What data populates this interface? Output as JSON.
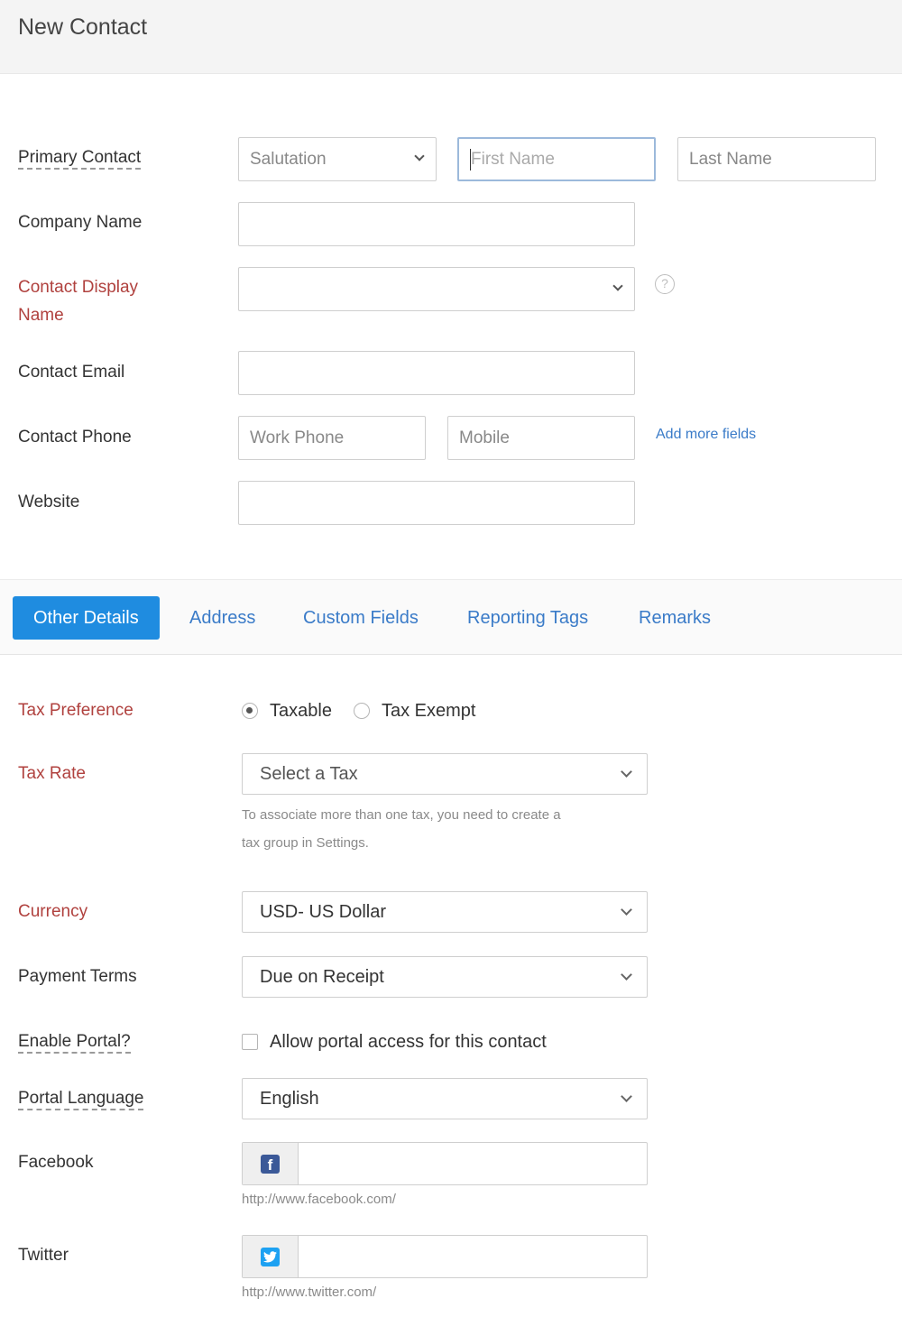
{
  "page": {
    "title": "New Contact"
  },
  "labels": {
    "primary_contact": "Primary Contact",
    "company_name": "Company Name",
    "display_name_line1": "Contact Display",
    "display_name_line2": "Name",
    "contact_email": "Contact Email",
    "contact_phone": "Contact Phone",
    "website": "Website",
    "tax_preference": "Tax Preference",
    "tax_rate": "Tax Rate",
    "currency": "Currency",
    "payment_terms": "Payment Terms",
    "enable_portal": "Enable Portal?",
    "portal_language": "Portal Language",
    "facebook": "Facebook",
    "twitter": "Twitter"
  },
  "primary_contact": {
    "salutation_placeholder": "Salutation",
    "first_name_placeholder": "First Name",
    "last_name_placeholder": "Last Name"
  },
  "company_name_value": "",
  "display_name_value": "",
  "contact_email_value": "",
  "phone": {
    "work_placeholder": "Work Phone",
    "mobile_placeholder": "Mobile",
    "add_more": "Add more fields"
  },
  "website_value": "",
  "tabs": [
    {
      "label": "Other Details",
      "active": true
    },
    {
      "label": "Address",
      "active": false
    },
    {
      "label": "Custom Fields",
      "active": false
    },
    {
      "label": "Reporting Tags",
      "active": false
    },
    {
      "label": "Remarks",
      "active": false
    }
  ],
  "tax_preference": {
    "options": [
      "Taxable",
      "Tax Exempt"
    ],
    "selected": "Taxable"
  },
  "tax_rate": {
    "placeholder": "Select a Tax",
    "hint_line1": "To associate more than one tax, you need to create a",
    "hint_line2": "tax group in Settings."
  },
  "currency": {
    "selected": "USD- US Dollar"
  },
  "payment_terms": {
    "selected": "Due on Receipt"
  },
  "portal": {
    "checkbox_label": "Allow portal access for this contact",
    "checked": false
  },
  "portal_language": {
    "selected": "English"
  },
  "facebook": {
    "icon": "facebook-icon",
    "glyph": "f",
    "url_prefix": "http://www.facebook.com/",
    "value": ""
  },
  "twitter": {
    "icon": "twitter-icon",
    "url_prefix": "http://www.twitter.com/",
    "value": ""
  },
  "colors": {
    "accent": "#1f8ce0",
    "link": "#3a7bc8",
    "required_label": "#b0413e"
  }
}
